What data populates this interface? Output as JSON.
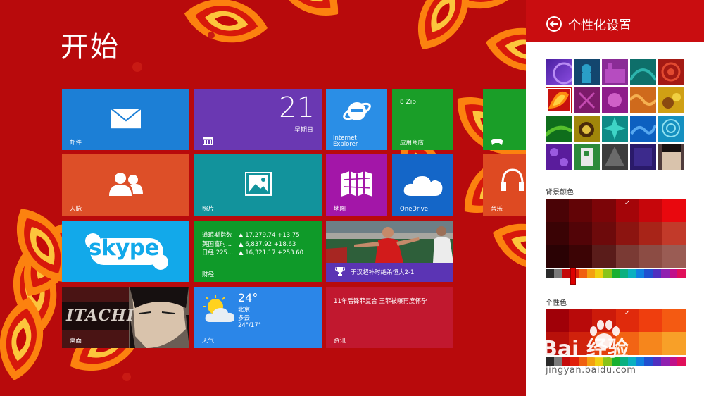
{
  "start": {
    "title": "开始"
  },
  "tiles": {
    "mail": {
      "label": "邮件",
      "color": "#1c7fd6"
    },
    "calendar": {
      "day": "21",
      "weekday": "星期日",
      "color": "#6a38b2"
    },
    "ie": {
      "line1": "Internet",
      "line2": "Explorer",
      "color": "#2a8ee6"
    },
    "store": {
      "top": "8 Zip",
      "label": "应用商店",
      "color": "#1a9e28"
    },
    "xbox": {
      "color": "#1a9e28"
    },
    "people": {
      "label": "人脉",
      "color": "#dd4f28"
    },
    "photos": {
      "label": "照片",
      "color": "#12939c"
    },
    "maps": {
      "label": "地图",
      "color": "#a316a8"
    },
    "onedrive": {
      "label": "OneDrive",
      "color": "#1466c8"
    },
    "music": {
      "label": "音乐",
      "color": "#de4a22"
    },
    "skype": {
      "label": "skype",
      "color": "#12a9ea"
    },
    "finance": {
      "label": "财经",
      "color": "#0f9a29",
      "rows": [
        {
          "name": "道琼斯指数",
          "value": "▲ 17,279.74 +13.75"
        },
        {
          "name": "英国富时...",
          "value": "▲ 6,837.92 +18.63"
        },
        {
          "name": "日经 225...",
          "value": "▲ 16,321.17 +253.60"
        }
      ]
    },
    "sports": {
      "caption": "于汉超补时绝杀恒大2-1",
      "color": "#5b34b4"
    },
    "desktop": {
      "label": "桌面",
      "art_text": "ITACHI"
    },
    "weather": {
      "temp": "24°",
      "city": "北京",
      "condition": "多云",
      "range": "24°/17°",
      "label": "天气",
      "color": "#2b86e8"
    },
    "news": {
      "headline": "11年后锋菲复合 王菲被曝再度怀孕",
      "label": "资讯",
      "color": "#c1182f"
    }
  },
  "panel": {
    "title": "个性化设置",
    "bg_color_label": "背景颜色",
    "accent_label": "个性色"
  },
  "watermark": {
    "text": "Bai  经验",
    "url": "jingyan.baidu.com"
  }
}
